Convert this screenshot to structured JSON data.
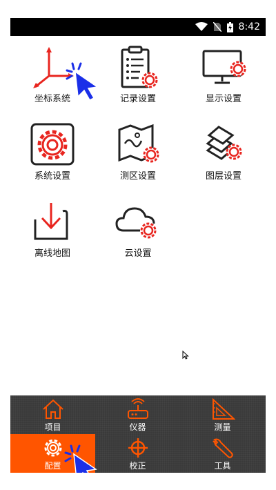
{
  "status": {
    "time": "8:42"
  },
  "grid": [
    {
      "label": "坐标系统"
    },
    {
      "label": "记录设置"
    },
    {
      "label": "显示设置"
    },
    {
      "label": "系统设置"
    },
    {
      "label": "测区设置"
    },
    {
      "label": "图层设置"
    },
    {
      "label": "离线地图"
    },
    {
      "label": "云设置"
    }
  ],
  "nav": [
    {
      "label": "项目"
    },
    {
      "label": "仪器"
    },
    {
      "label": "测量"
    },
    {
      "label": "配置"
    },
    {
      "label": "校正"
    },
    {
      "label": "工具"
    }
  ],
  "colors": {
    "accent": "#ff5500",
    "icon_red": "#e8251f",
    "nav_bg": "#3a3a3a",
    "cursor_blue": "#1a2fe8"
  }
}
